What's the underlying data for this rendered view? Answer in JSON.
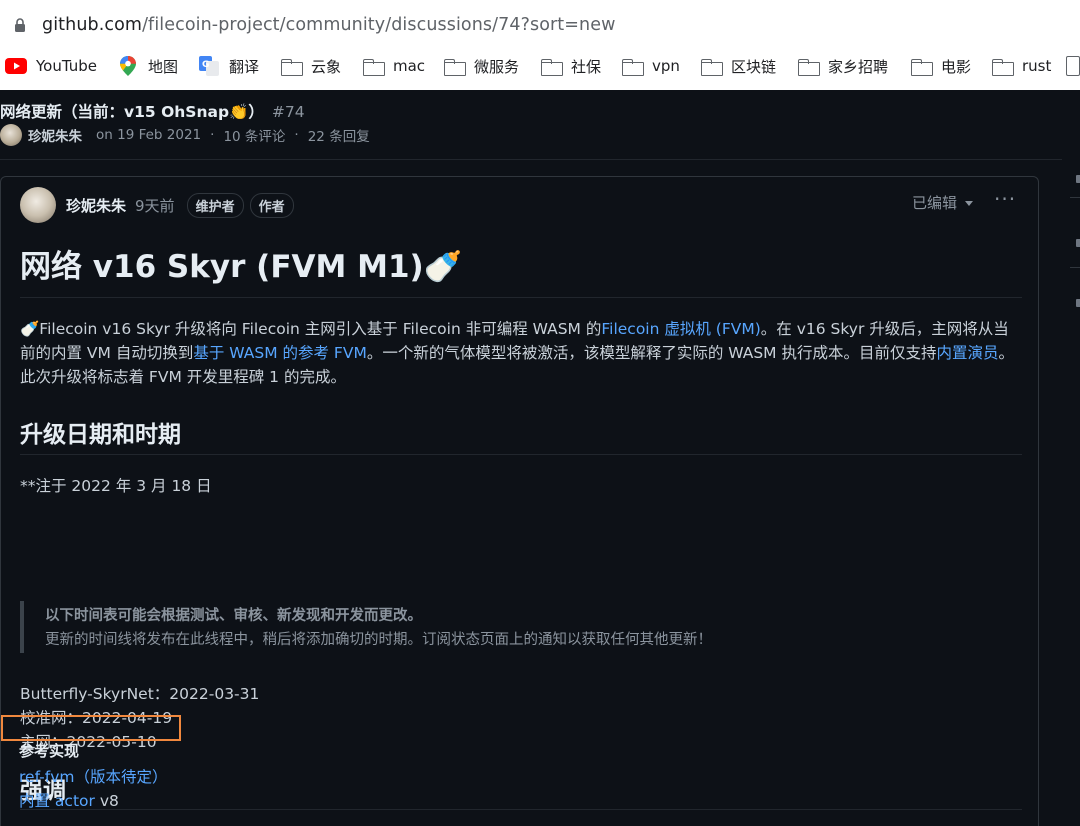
{
  "browser": {
    "url_host": "github.com",
    "url_path": "/filecoin-project/community/discussions/74?sort=new",
    "bookmarks": [
      {
        "label": "YouTube",
        "icon": "youtube-icon"
      },
      {
        "label": "地图",
        "icon": "maps-pin-icon"
      },
      {
        "label": "翻译",
        "icon": "translate-icon"
      },
      {
        "label": "云象",
        "icon": "folder-icon"
      },
      {
        "label": "mac",
        "icon": "folder-icon"
      },
      {
        "label": "微服务",
        "icon": "folder-icon"
      },
      {
        "label": "社保",
        "icon": "folder-icon"
      },
      {
        "label": "vpn",
        "icon": "folder-icon"
      },
      {
        "label": "区块链",
        "icon": "folder-icon"
      },
      {
        "label": "家乡招聘",
        "icon": "folder-icon"
      },
      {
        "label": "电影",
        "icon": "folder-icon"
      },
      {
        "label": "rust",
        "icon": "folder-icon"
      }
    ]
  },
  "discussion": {
    "title": "网络更新（当前：v15 OhSnap👏）",
    "number": "#74",
    "author": "珍妮朱朱",
    "date": "on 19 Feb 2021",
    "comments": "10 条评论",
    "replies": "22 条回复"
  },
  "post": {
    "author": "珍妮朱朱",
    "time": "9天前",
    "badges": [
      "维护者",
      "作者"
    ],
    "edited": "已编辑",
    "more": "···",
    "heading": "网络 v16 Skyr (FVM M1)🍼",
    "intro": {
      "t1": "🍼Filecoin v16 Skyr 升级将向 Filecoin 主网引入基于 Filecoin 非可编程 WASM 的",
      "l1": "Filecoin 虚拟机 (FVM)",
      "t2": "。在 v16 Skyr 升级后，主网将从当前的内置 VM 自动切换到",
      "l2": "基于 WASM 的参考 FVM",
      "t3": "。一个新的气体模型将被激活，该模型解释了实际的 WASM 执行成本。目前仅支持",
      "l3": "内置演员",
      "t4": "。此次升级将标志着 FVM 开发里程碑 1 的完成。"
    },
    "section_dates": "升级日期和时期",
    "note": "**注于 2022 年 3 月 18 日",
    "quote_bold": "以下时间表可能会根据测试、审核、新发现和开发而更改。",
    "quote_text": "更新的时间线将发布在此线程中，稍后将添加确切的时期。订阅状态页面上的通知以获取任何其他更新！",
    "schedule": [
      "Butterfly-SkyrNet：2022-03-31",
      "校准网：2022-04-19",
      "主网：2022-05-10"
    ],
    "section_highlights": "强调",
    "ref_impl": "参考实现",
    "ref_link": "ref-fvm（版本待定）",
    "builtin_link": "内置 actor",
    "builtin_suffix": " v8"
  },
  "colors": {
    "page_bg": "#0d1117",
    "link": "#58a6ff",
    "highlight_box": "#f0883e"
  }
}
